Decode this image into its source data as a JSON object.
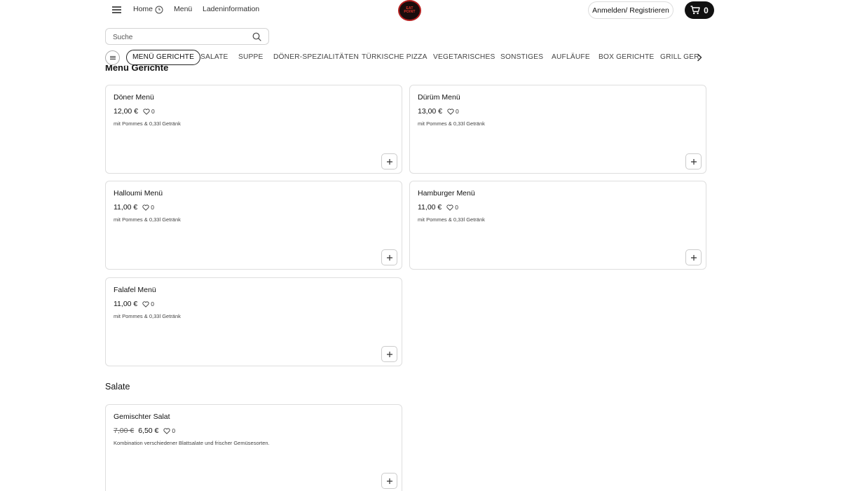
{
  "header": {
    "nav": {
      "home": "Home",
      "menu": "Menü",
      "store_info": "Ladeninformation"
    },
    "login_label": "Anmelden/ Registrieren",
    "cart_count": "0",
    "logo_text": [
      "EAT",
      "POINT"
    ]
  },
  "search": {
    "placeholder": "Suche"
  },
  "categories": [
    "MENÜ GERICHTE",
    "SALATE",
    "SUPPE",
    "DÖNER-SPEZIALITÄTEN",
    "TÜRKISCHE PIZZA",
    "VEGETARISCHES",
    "SONSTIGES",
    "AUFLÄUFE",
    "BOX GERICHTE",
    "GRILL GER"
  ],
  "sections": {
    "menu": {
      "title": "Menü Gerichte",
      "items": [
        {
          "name": "Döner Menü",
          "price": "12,00 €",
          "likes": "0",
          "description": "mit Pommes & 0,33l Getränk"
        },
        {
          "name": "Dürüm Menü",
          "price": "13,00 €",
          "likes": "0",
          "description": "mit Pommes & 0,33l Getränk"
        },
        {
          "name": "Halloumi Menü",
          "price": "11,00 €",
          "likes": "0",
          "description": "mit Pommes & 0,33l Getränk"
        },
        {
          "name": "Hamburger Menü",
          "price": "11,00 €",
          "likes": "0",
          "description": "mit Pommes & 0,33l Getränk"
        },
        {
          "name": "Falafel Menü",
          "price": "11,00 €",
          "likes": "0",
          "description": "mit Pommes & 0,33l Getränk"
        }
      ]
    },
    "salads": {
      "title": "Salate",
      "items": [
        {
          "name": "Gemischter Salat",
          "old_price": "7,00 €",
          "price": "6,50 €",
          "likes": "0",
          "description": "Kombination verschiedener Blattsalate und frischer Gemüsesorten."
        }
      ]
    }
  },
  "colors": {
    "accent": "#111111",
    "border": "#dedede",
    "logo_red": "#e3362c"
  }
}
